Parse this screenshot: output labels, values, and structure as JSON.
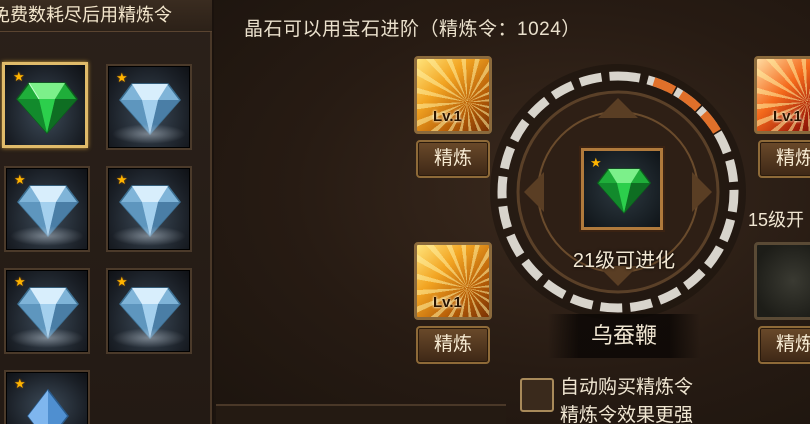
{
  "left_panel": {
    "hint": "免费数耗尽后用精炼令",
    "gems": [
      {
        "type": "green",
        "star": "★",
        "selected": true
      },
      {
        "type": "blue",
        "star": "★",
        "selected": false
      },
      {
        "type": "blue",
        "star": "★",
        "selected": false
      },
      {
        "type": "blue",
        "star": "★",
        "selected": false
      },
      {
        "type": "blue",
        "star": "★",
        "selected": false
      },
      {
        "type": "blue",
        "star": "★",
        "selected": false
      },
      {
        "type": "blue",
        "star": "★",
        "selected": false
      }
    ]
  },
  "main": {
    "title": "晶石可以用宝石进阶（精炼令：1024）",
    "skills": [
      {
        "level": "Lv.1",
        "button": "精炼",
        "color": "gold"
      },
      {
        "level": "Lv.1",
        "button": "精炼",
        "color": "red"
      },
      {
        "level": "Lv.1",
        "button": "精炼",
        "color": "gold"
      },
      {
        "level": "",
        "button": "精炼",
        "color": "dark"
      }
    ],
    "center_gem": {
      "star": "★",
      "type": "green"
    },
    "evolve_text": "21级可进化",
    "skill_name": "乌蚕鞭",
    "unlock_text": "15级开",
    "auto_buy_label": "自动购买精炼令",
    "effect_label": "精炼令效果更强"
  },
  "colors": {
    "accent_gold": "#e0bb6a",
    "ring_progress": "#e0702a",
    "star": "#ffb400"
  },
  "icons": [
    "star-icon",
    "green-gem-icon",
    "blue-gem-icon",
    "checkbox-icon"
  ]
}
